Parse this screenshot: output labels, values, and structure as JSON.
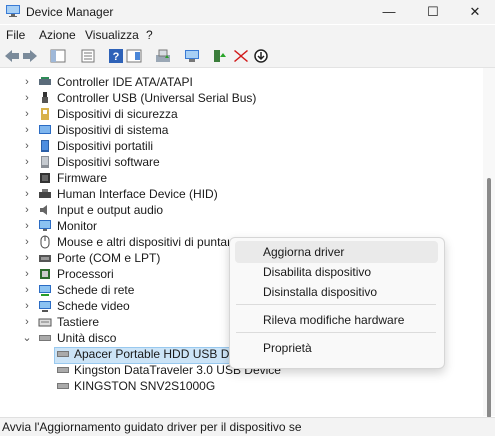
{
  "window": {
    "title": "Device Manager",
    "minimize": "—",
    "maximize": "☐",
    "close": "✕"
  },
  "menu": [
    "File",
    "Azione",
    "Visualizza",
    "?"
  ],
  "tree": [
    {
      "label": "Controller IDE ATA/ATAPI",
      "icon": "ide-controller-icon"
    },
    {
      "label": "Controller USB (Universal Serial Bus)",
      "icon": "usb-icon"
    },
    {
      "label": "Dispositivi di sicurezza",
      "icon": "security-key-icon"
    },
    {
      "label": "Dispositivi di sistema",
      "icon": "system-devices-icon"
    },
    {
      "label": "Dispositivi portatili",
      "icon": "portable-device-icon"
    },
    {
      "label": "Dispositivi software",
      "icon": "software-device-icon"
    },
    {
      "label": "Firmware",
      "icon": "firmware-icon"
    },
    {
      "label": "Human Interface Device (HID)",
      "icon": "hid-icon"
    },
    {
      "label": "Input e output audio",
      "icon": "speaker-icon"
    },
    {
      "label": "Monitor",
      "icon": "monitor-icon"
    },
    {
      "label": "Mouse e altri dispositivi di puntamento",
      "icon": "mouse-icon"
    },
    {
      "label": "Porte (COM e LPT)",
      "icon": "port-icon"
    },
    {
      "label": "Processori",
      "icon": "processor-icon"
    },
    {
      "label": "Schede di rete",
      "icon": "network-adapter-icon"
    },
    {
      "label": "Schede video",
      "icon": "display-adapter-icon"
    },
    {
      "label": "Tastiere",
      "icon": "keyboard-icon"
    },
    {
      "label": "Unità disco",
      "icon": "disk-drive-icon",
      "expanded": true
    }
  ],
  "disks": [
    {
      "label": "Apacer Portable HDD USB Device",
      "selected": true
    },
    {
      "label": "Kingston DataTraveler 3.0 USB Device"
    },
    {
      "label": "KINGSTON SNV2S1000G"
    }
  ],
  "context_menu": {
    "update": "Aggiorna driver",
    "disable": "Disabilita dispositivo",
    "uninstall": "Disinstalla dispositivo",
    "scan": "Rileva modifiche hardware",
    "properties": "Proprietà"
  },
  "status": "Avvia l'Aggiornamento guidato driver per il dispositivo selezionato.",
  "colors": {
    "selection": "#cce4f7",
    "accent_blue": "#0067c0",
    "delete_red": "#d11a1a"
  }
}
